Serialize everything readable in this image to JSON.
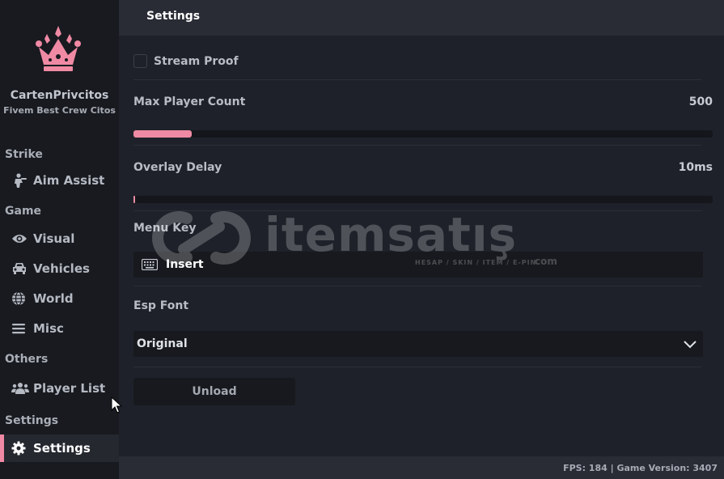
{
  "app": {
    "brand_name": "CartenPrivcitos",
    "brand_subtitle": "Fivem Best Crew Citos",
    "logo_icon": "crown-icon",
    "accent_color": "#f08aa4"
  },
  "sidebar": {
    "sections": [
      {
        "title": "Strike",
        "items": [
          {
            "label": "Aim Assist",
            "icon": "aim-figure-icon"
          }
        ]
      },
      {
        "title": "Game",
        "items": [
          {
            "label": "Visual",
            "icon": "eye-icon"
          },
          {
            "label": "Vehicles",
            "icon": "car-icon"
          },
          {
            "label": "World",
            "icon": "globe-icon"
          },
          {
            "label": "Misc",
            "icon": "menu-lines-icon"
          }
        ]
      },
      {
        "title": "Others",
        "items": [
          {
            "label": "Player List",
            "icon": "users-icon"
          }
        ]
      },
      {
        "title": "Settings",
        "items": [
          {
            "label": "Settings",
            "icon": "gear-icon",
            "active": true
          }
        ]
      }
    ]
  },
  "header": {
    "title": "Settings"
  },
  "settings": {
    "stream_proof": {
      "label": "Stream Proof",
      "checked": false
    },
    "max_player_count": {
      "label": "Max Player Count",
      "value": "500",
      "fill_percent": 10
    },
    "overlay_delay": {
      "label": "Overlay Delay",
      "value": "10ms",
      "fill_percent": 0.3
    },
    "menu_key": {
      "label": "Menu Key",
      "value": "Insert",
      "icon": "keyboard-icon"
    },
    "esp_font": {
      "label": "Esp Font",
      "selected": "Original",
      "icon": "chevron-down-icon"
    },
    "unload_label": "Unload"
  },
  "footer": {
    "text": "FPS: 184 | Game Version: 3407"
  },
  "watermark": {
    "text": "itemsatış",
    "sub": "HESAP / SKIN / ITEM / E-PIN",
    "com": "com"
  }
}
